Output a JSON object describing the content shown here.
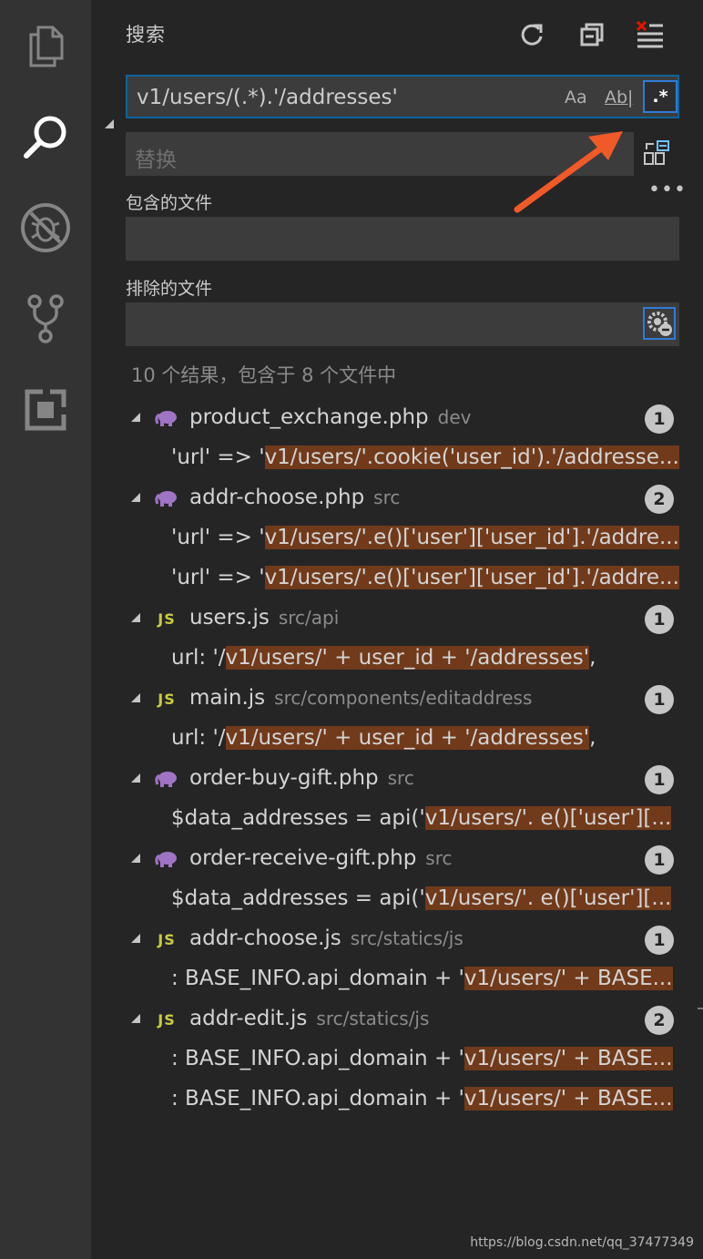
{
  "activity_bar": {
    "icons": [
      "files-icon",
      "search-icon",
      "debug-icon",
      "source-control-icon",
      "extensions-icon"
    ]
  },
  "search_panel": {
    "title": "搜索",
    "search": {
      "value": "v1/users/(.*).'/addresses'",
      "match_case": "Aa",
      "match_word": "Ab|",
      "regex": ".*"
    },
    "replace": {
      "placeholder": "替换"
    },
    "include_label": "包含的文件",
    "exclude_label": "排除的文件",
    "more": "•••",
    "summary": "10 个结果，包含于 8 个文件中"
  },
  "results": [
    {
      "file": "product_exchange.php",
      "path": "dev",
      "type": "php",
      "count": "1",
      "matches": [
        {
          "pre": "'url' => '",
          "hl": "v1/users/'.cookie('user_id').'/addresse...",
          "post": ""
        }
      ]
    },
    {
      "file": "addr-choose.php",
      "path": "src",
      "type": "php",
      "count": "2",
      "matches": [
        {
          "pre": "'url' => '",
          "hl": "v1/users/'.e()['user']['user_id'].'/addre...",
          "post": ""
        },
        {
          "pre": "'url' => '",
          "hl": "v1/users/'.e()['user']['user_id'].'/addre...",
          "post": ""
        }
      ]
    },
    {
      "file": "users.js",
      "path": "src/api",
      "type": "js",
      "count": "1",
      "matches": [
        {
          "pre": "url: '/",
          "hl": "v1/users/' + user_id + '/addresses'",
          "post": ","
        }
      ]
    },
    {
      "file": "main.js",
      "path": "src/components/editaddress",
      "type": "js",
      "count": "1",
      "matches": [
        {
          "pre": "url: '/",
          "hl": "v1/users/' + user_id + '/addresses'",
          "post": ","
        }
      ]
    },
    {
      "file": "order-buy-gift.php",
      "path": "src",
      "type": "php",
      "count": "1",
      "matches": [
        {
          "pre": "$data_addresses = api('",
          "hl": "v1/users/'. e()['user'][...",
          "post": ""
        }
      ]
    },
    {
      "file": "order-receive-gift.php",
      "path": "src",
      "type": "php",
      "count": "1",
      "matches": [
        {
          "pre": "$data_addresses = api('",
          "hl": "v1/users/'. e()['user'][...",
          "post": ""
        }
      ]
    },
    {
      "file": "addr-choose.js",
      "path": "src/statics/js",
      "type": "js",
      "count": "1",
      "matches": [
        {
          "pre": ": BASE_INFO.api_domain + '",
          "hl": "v1/users/' + BASE...",
          "post": ""
        }
      ]
    },
    {
      "file": "addr-edit.js",
      "path": "src/statics/js",
      "type": "js",
      "count": "2",
      "matches": [
        {
          "pre": ": BASE_INFO.api_domain + '",
          "hl": "v1/users/' + BASE...",
          "post": ""
        },
        {
          "pre": ": BASE_INFO.api_domain + '",
          "hl": "v1/users/' + BASE...",
          "post": ""
        }
      ]
    }
  ],
  "js_icon_label": "JS",
  "watermark": "https://blog.csdn.net/qq_37477349",
  "colors": {
    "highlight": "#713a1b",
    "accent": "#2f7bd8",
    "arrow": "#f05a28",
    "php_icon": "#a074c4",
    "js_icon": "#cbcb41"
  }
}
